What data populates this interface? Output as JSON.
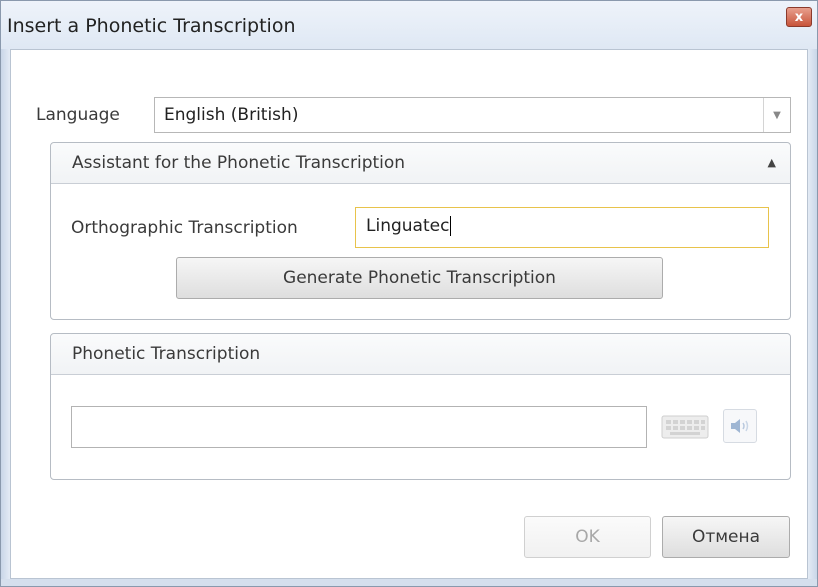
{
  "window": {
    "title": "Insert a Phonetic Transcription",
    "close_glyph": "x"
  },
  "language": {
    "label": "Language",
    "selected": "English (British)"
  },
  "assistant": {
    "title": "Assistant for the Phonetic Transcription",
    "orthographic_label": "Orthographic Transcription",
    "orthographic_value": "Linguatec",
    "generate_button": "Generate Phonetic Transcription"
  },
  "phonetic": {
    "title": "Phonetic Transcription",
    "value": ""
  },
  "icons": {
    "collapse": "chevron-up-icon",
    "keyboard": "keyboard-icon",
    "speaker": "speaker-icon"
  },
  "footer": {
    "ok_label": "OK",
    "cancel_label": "Отмена"
  },
  "colors": {
    "focus_border": "#e8c34b",
    "close_button": "#c8543a",
    "frame": "#c9d6e8"
  }
}
